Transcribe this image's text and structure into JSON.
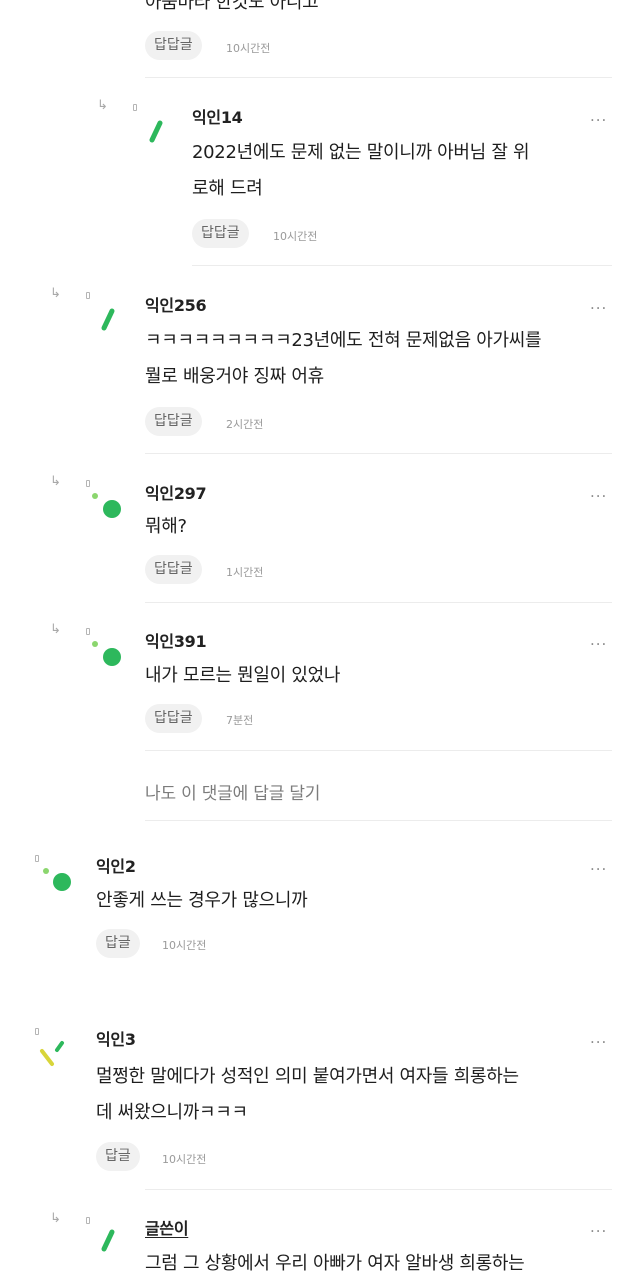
{
  "top_partial": {
    "text": "아줌마라 한것도 아니고",
    "reply_label": "답답글",
    "time": "10시간전"
  },
  "replies": [
    {
      "author": "익인14",
      "text": "2022년에도 문제 없는 말이니까 아버님 잘 위\n로해 드려",
      "reply_label": "답답글",
      "time": "10시간전",
      "avatar": "green-stick"
    },
    {
      "author": "익인256",
      "text": "ㅋㅋㅋㅋㅋㅋㅋㅋㅋ23년에도 전혀 문제없음 아가씨를\n뭘로 배웅거야 징짜 어휴",
      "reply_label": "답답글",
      "time": "2시간전",
      "avatar": "green-stick"
    },
    {
      "author": "익인297",
      "text": "뭐해?",
      "reply_label": "답답글",
      "time": "1시간전",
      "avatar": "green-dots"
    },
    {
      "author": "익인391",
      "text": "내가 모르는 뭔일이 있었나",
      "reply_label": "답답글",
      "time": "7분전",
      "avatar": "green-dots"
    }
  ],
  "add_reply_label": "나도 이 댓글에 답글 달기",
  "comments": [
    {
      "author": "익인2",
      "text": "안좋게 쓰는 경우가 많으니까",
      "reply_label": "답글",
      "time": "10시간전",
      "avatar": "green-dots"
    },
    {
      "author": "익인3",
      "text": "멀쩡한 말에다가 성적인 의미 붙여가면서 여자들 희롱하는\n데 써왔으니까ㅋㅋㅋ",
      "reply_label": "답글",
      "time": "10시간전",
      "avatar": "yellow-check"
    }
  ],
  "op_reply": {
    "author": "글쓴이",
    "text": "그럼 그 상황에서 우리 아빠가 여자 알바생 희롱하는",
    "avatar": "green-stick"
  },
  "more_label": "...",
  "reply_arrow_icon": "↳",
  "colors": {
    "accent_green": "#2db85c",
    "light_green": "#8bd66e",
    "yellow": "#d8d53a",
    "button_bg": "#f1f1f1"
  }
}
